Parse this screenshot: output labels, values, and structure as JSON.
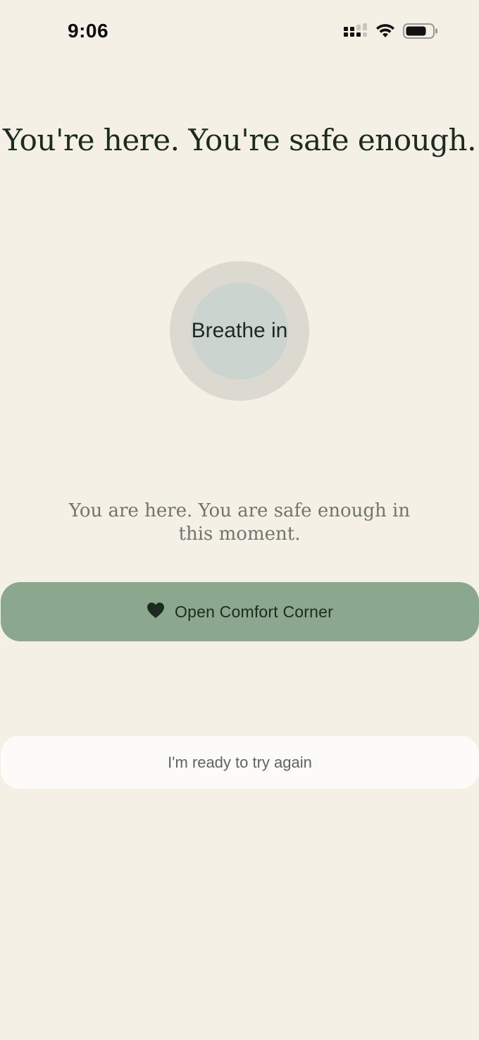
{
  "status_bar": {
    "time": "9:06",
    "icons": [
      "cellular-signal-icon",
      "wifi-icon",
      "battery-icon"
    ]
  },
  "screen": {
    "headline": "You're here. You're safe enough.",
    "breath_circle": {
      "label": "Breathe in"
    },
    "reassurance": "You are here. You are safe enough in this moment.",
    "comfort_button": {
      "label": "Open Comfort Corner",
      "icon": "heart-icon"
    },
    "retry_button": {
      "label": "I'm ready to try again"
    }
  },
  "colors": {
    "background": "#f5f0e6",
    "accent": "#8ba88f",
    "text_dark": "#1d2a20",
    "text_muted": "#707570"
  }
}
